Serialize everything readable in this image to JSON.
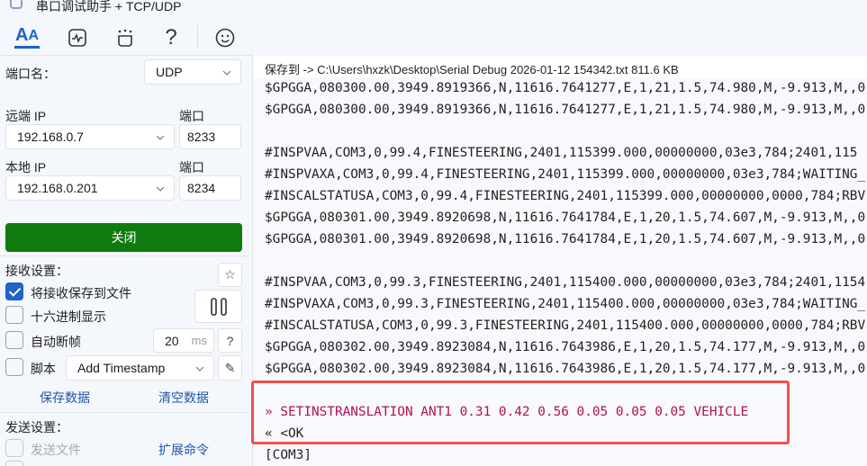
{
  "window": {
    "title": "串口调试助手 + TCP/UDP"
  },
  "toolbar": {
    "icons": [
      "font-icon",
      "waveform-icon",
      "plugin-icon",
      "help-icon",
      "smiley-icon"
    ],
    "help_glyph": "?"
  },
  "left": {
    "port_name_label": "端口名：",
    "port_name_value": "UDP",
    "remote_ip_label": "远端 IP",
    "remote_ip_value": "192.168.0.7",
    "remote_port_label": "端口",
    "remote_port_value": "8233",
    "local_ip_label": "本地 IP",
    "local_ip_value": "192.168.0.201",
    "local_port_label": "端口",
    "local_port_value": "8234",
    "close_button": "关闭",
    "receive_settings_label": "接收设置：",
    "save_to_file_label": "将接收保存到文件",
    "save_to_file_checked": true,
    "hex_display_label": "十六进制显示",
    "hex_display_checked": false,
    "auto_frame_label": "自动断帧",
    "auto_frame_checked": false,
    "auto_frame_value": "20",
    "auto_frame_unit": "ms",
    "auto_frame_help": "?",
    "script_label": "脚本",
    "script_checked": false,
    "script_value": "Add Timestamp",
    "save_data_link": "保存数据",
    "clear_data_link": "清空数据",
    "send_settings_label": "发送设置：",
    "send_file_label": "发送文件",
    "send_file_checked": false,
    "extend_cmd_link": "扩展命令"
  },
  "main": {
    "save_path": "保存到 ->  C:\\Users\\hxzk\\Desktop\\Serial Debug 2026-01-12 154342.txt  811.6 KB",
    "lines": [
      "$GPGGA,080300.00,3949.8919366,N,11616.7641277,E,1,21,1.5,74.980,M,-9.913,M,,0",
      "$GPGGA,080300.00,3949.8919366,N,11616.7641277,E,1,21,1.5,74.980,M,-9.913,M,,0",
      "",
      "#INSPVAA,COM3,0,99.4,FINESTEERING,2401,115399.000,00000000,03e3,784;2401,115",
      "#INSPVAXA,COM3,0,99.4,FINESTEERING,2401,115399.000,00000000,03e3,784;WAITING_",
      "#INSCALSTATUSA,COM3,0,99.4,FINESTEERING,2401,115399.000,00000000,0000,784;RBV",
      "$GPGGA,080301.00,3949.8920698,N,11616.7641784,E,1,20,1.5,74.607,M,-9.913,M,,0",
      "$GPGGA,080301.00,3949.8920698,N,11616.7641784,E,1,20,1.5,74.607,M,-9.913,M,,0",
      "",
      "#INSPVAA,COM3,0,99.3,FINESTEERING,2401,115400.000,00000000,03e3,784;2401,1154",
      "#INSPVAXA,COM3,0,99.3,FINESTEERING,2401,115400.000,00000000,03e3,784;WAITING_",
      "#INSCALSTATUSA,COM3,0,99.3,FINESTEERING,2401,115400.000,00000000,0000,784;RBV",
      "$GPGGA,080302.00,3949.8923084,N,11616.7643986,E,1,20,1.5,74.177,M,-9.913,M,,0",
      "$GPGGA,080302.00,3949.8923084,N,11616.7643986,E,1,20,1.5,74.177,M,-9.913,M,,0",
      ""
    ],
    "sent_command": "» SETINSTRANSLATION ANT1 0.31 0.42 0.56 0.05 0.05 0.05 VEHICLE",
    "reply": "« <OK",
    "port_tag": "[COM3]"
  },
  "colors": {
    "accent": "#1e63c6",
    "close_button": "#0f7b0f",
    "sent_text": "#b0105a",
    "highlight_box": "#f24f4f"
  }
}
